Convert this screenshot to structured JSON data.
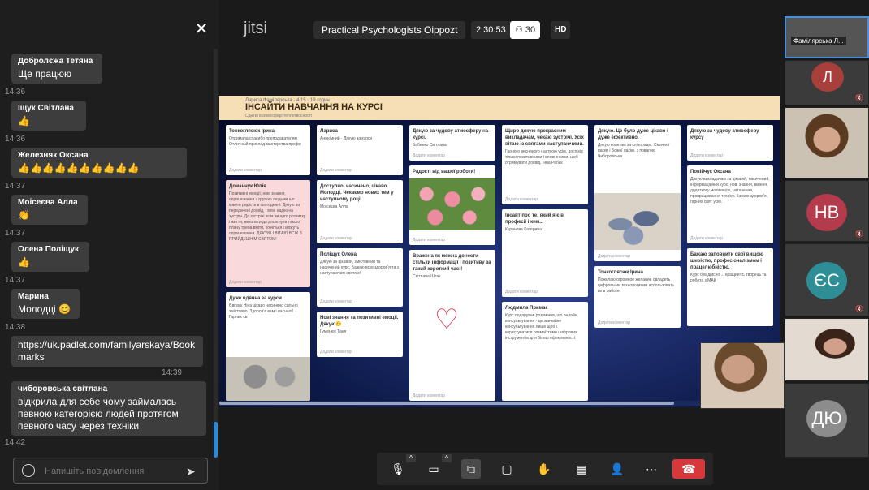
{
  "chat": {
    "close_icon": "✕",
    "messages": [
      {
        "author": "Добролєжа Тетяна",
        "text": "Ще працюю",
        "time": "14:36"
      },
      {
        "author": "Іщук Світлана",
        "text": "👍",
        "time": "14:36"
      },
      {
        "author": "Железняк Оксана",
        "text": "👍👍👍👍👍👍👍👍👍👍",
        "time": "14:37"
      },
      {
        "author": "Моісеєва Алла",
        "text": "👏",
        "time": "14:37"
      },
      {
        "author": "Олена Поліщук",
        "text": "👍",
        "time": "14:37"
      },
      {
        "author": "Марина",
        "text": "Молодці 😊",
        "time": "14:38"
      },
      {
        "author": "",
        "text": "https://uk.padlet.com/familyarskaya/Bookmarks",
        "time": "14:39"
      },
      {
        "author": "чиборовська світлана",
        "text": "відкрила для себе чому займалась певною категорією людей протягом певного часу через техніки",
        "time": "14:42"
      }
    ],
    "input_placeholder": "Напишіть повідомлення",
    "send_icon": "send-icon"
  },
  "header": {
    "logo": "jitsi",
    "meeting_title": "Practical Psychologists Oippozt",
    "timer": "2:30:53",
    "participants": "30",
    "quality": "HD"
  },
  "padlet": {
    "meta": "Лариса Фамілярська · 4 15 · 19 годин",
    "title": "ІНСАЙТИ НАВЧАННЯ НА КУРСІ",
    "subtitle": "Сдієно в атмосфері теплотвоєності",
    "add_comment": "Додати коментар",
    "cards": [
      {
        "title": "Тонкоглясюк Ірина",
        "body": "Отримала спасибо преподавателям Отличный приклад мастерства профи"
      },
      {
        "title": "Доманчук Юлія",
        "body": "Позитивні емоції, нові знання, опрацювання з групою людьми що мають радість в сьогоденні. Дякую за передачені досвід, і мою надію на зустріч. До зустрічі всім вищого розвитку і життя, виконати до досягнути такого плану треба вміти, хочеться і можуть опрацювання. ДЯКУЮ І ВІТАЮ ВСІХ З ПРИЙДЕШНІМ СВЯТОМ!"
      },
      {
        "title": "Дуже вдячна за курси",
        "body": "Євпаук Ніна цікаво насичено сильно змістовно. Здоров'я вам і насналі! Гарних св"
      },
      {
        "title": "Лариса",
        "body": "Анонімний · Дякую за курси"
      },
      {
        "title": "Доступно, насичено, цікаво. Молодці. Чекаємо нових тем у наступному році!",
        "body": "Моісеєва Алла"
      },
      {
        "title": "Поліщук Олена",
        "body": "Дякую за цікавий, змістовний та насичений курс. Бажаю всім здоров'я та з наступаючим святом!"
      },
      {
        "title": "Нові знання та позитивні емоції. Дякую😊",
        "body": "Гуменюк Таня"
      },
      {
        "title": "Дякую за чудову атмосферу на курсі.",
        "body": "Бабенко Світлана"
      },
      {
        "title": "Радості від вашої роботи!",
        "body": ""
      },
      {
        "title": "Вражена як можна донести стільки інформації і позитиву за такий короткий час!!",
        "body": "Світлана Шпак"
      },
      {
        "title": "Щиро дякую прекрасним викладачам, чекаю зустрічі. Усіх вітаю із святами наступаючими.",
        "body": "Гарного весняного настрою усім, доспіхів тільки позитивними і впевненими, щоб отримувати досвід. Інна Рабєк"
      },
      {
        "title": "Інсайт про те, який я є в професії і ким...",
        "body": "Куранова Катерина"
      },
      {
        "title": "Людмила Примак",
        "body": "Курс подарував розуміння, що онлайн консультування - це звичайне консультування лише щоб і користуватися розмаїттями цифрових інструментів для більш ефективності."
      },
      {
        "title": "Дякую. Це було дуже цікаво і дуже ефективно.",
        "body": "Дякую колегам за співпрацю. Смачної паски і Божої ласки. з повагою Чиборовська"
      },
      {
        "title": "Тонкоглясюк Ірина",
        "body": "Пожелаю огромное желание овладеть цифровыми технологиями использовать их в работе"
      },
      {
        "title": "Дякую за чудову атмосферу курсу",
        "body": ""
      },
      {
        "title": "Повійчук Оксана",
        "body": "Дякую викладачам за цікавий, насичений, інформаційний курс, нові знання, вміння, додаткову мотивацію, натхнення, пропрацювання техніку. Бажаю здоров'я, гарних свят усім."
      },
      {
        "title": "Бажаю заповнити свої вищою щирістю, професіоналізмом і працелюбністю.",
        "body": "Курс був дійсно ... кращий! Є творець та робота з МАК"
      }
    ]
  },
  "toolbar": {
    "mic_icon": "microphone-icon",
    "camera_icon": "camera-icon",
    "share_icon": "screen-share-icon",
    "chat_icon": "chat-icon",
    "hand_icon": "raise-hand-icon",
    "tile_icon": "tile-view-icon",
    "invite_icon": "invite-icon",
    "more_icon": "more-icon",
    "hangup_icon": "hangup-icon"
  },
  "filmstrip": [
    {
      "label": "Фамілярська Л..."
    },
    {
      "initials": "Л",
      "color": "#a73f3a"
    },
    {
      "initials": ""
    },
    {
      "initials": "НВ",
      "color": "#b33b4b"
    },
    {
      "initials": "ЄС",
      "color": "#2d8f95"
    },
    {
      "initials": ""
    },
    {
      "initials": "ДЮ",
      "color": "#8c8c8c"
    }
  ]
}
